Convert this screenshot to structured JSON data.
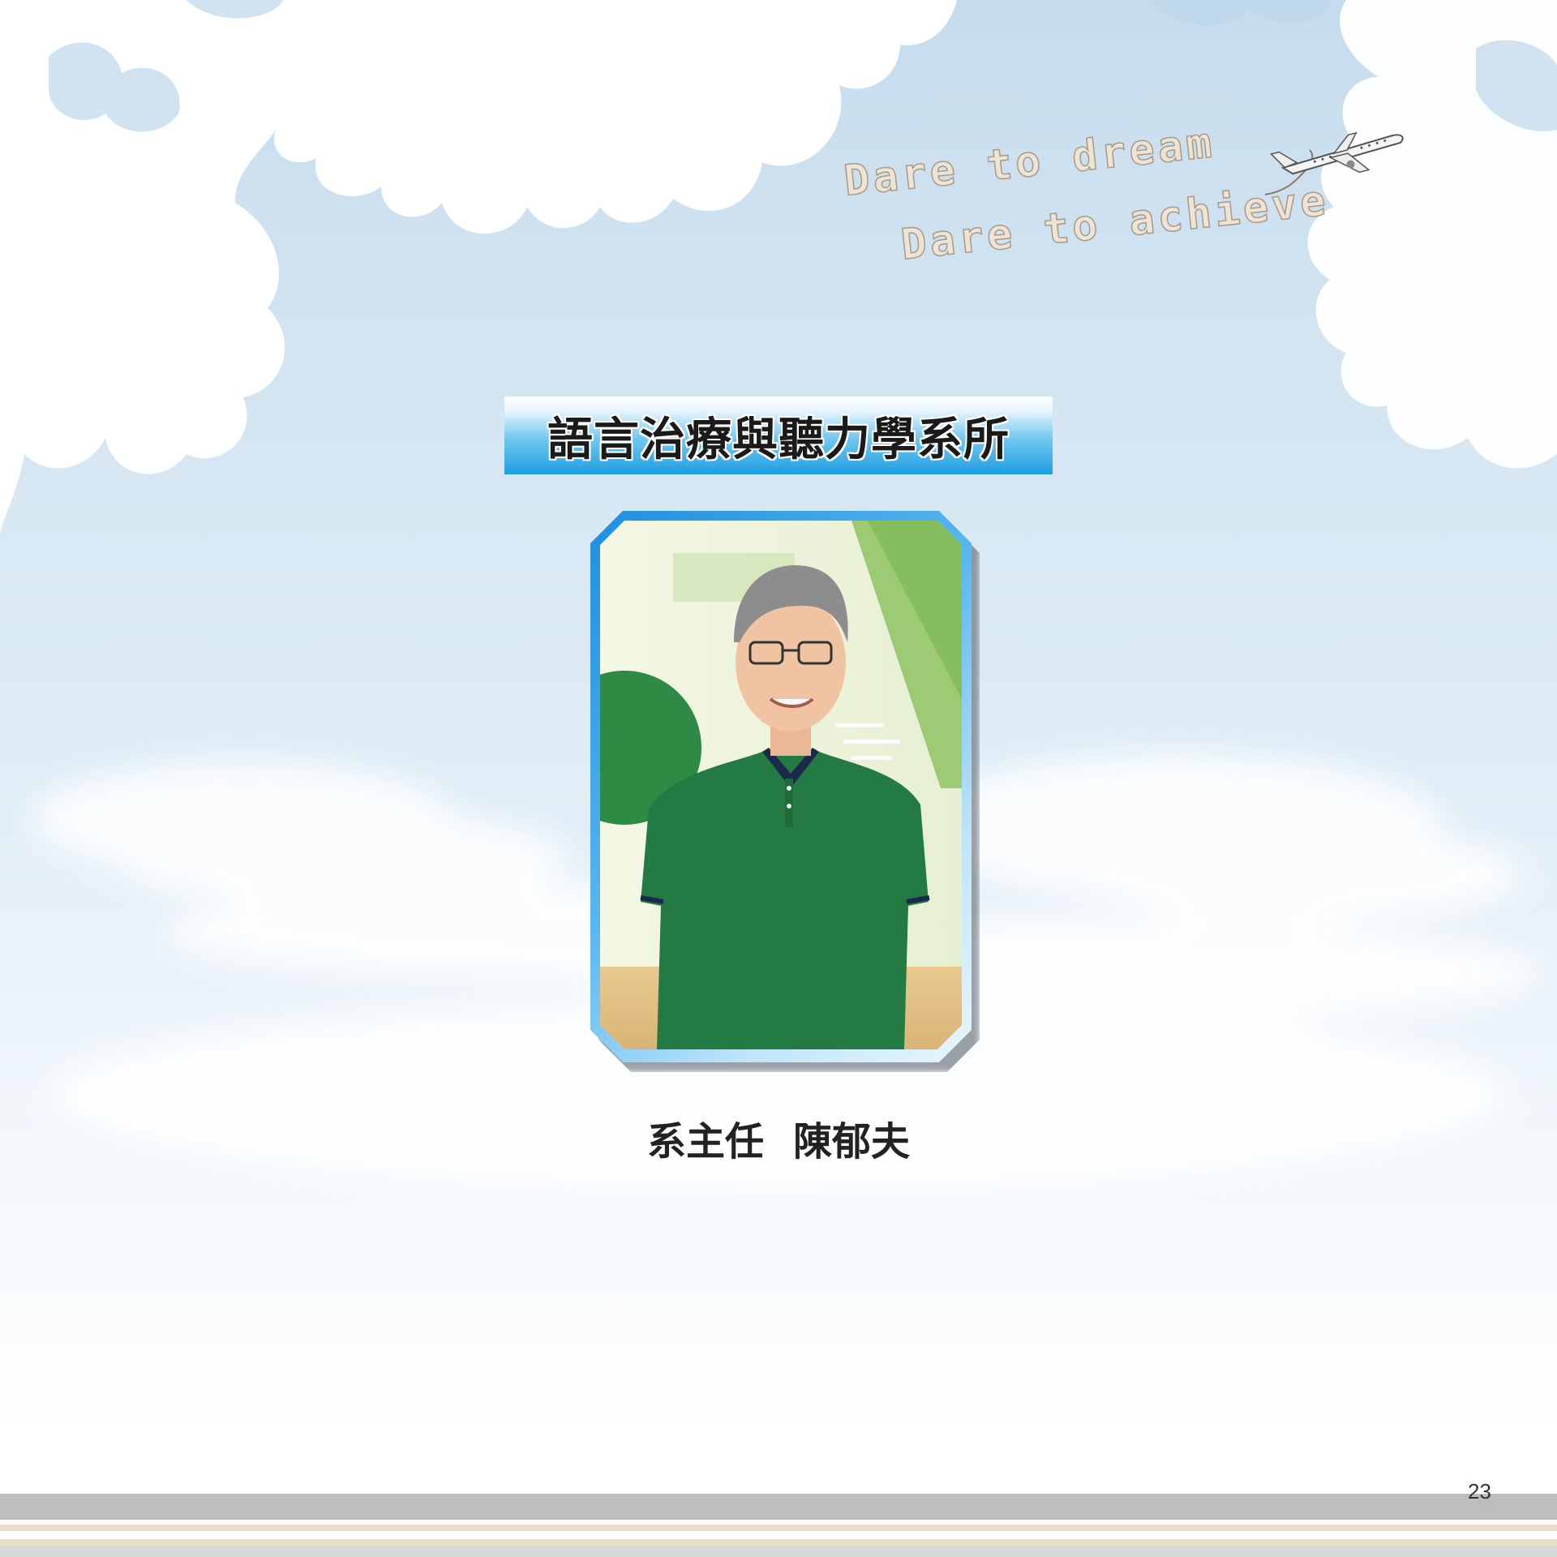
{
  "slogan": {
    "line1": "Dare to dream",
    "line2": "Dare to achieve"
  },
  "department": {
    "title": "語言治療與聽力學系所"
  },
  "portrait": {
    "subject": "photo-of-department-chair",
    "shirt_color": "#247a43"
  },
  "caption": {
    "role": "系主任",
    "name": "陳郁夫"
  },
  "footer": {
    "page_number": "23"
  },
  "colors": {
    "banner_blue": "#1f9fe0",
    "frame_blue": "#1e8fe0",
    "sky_top": "#c6dced"
  }
}
